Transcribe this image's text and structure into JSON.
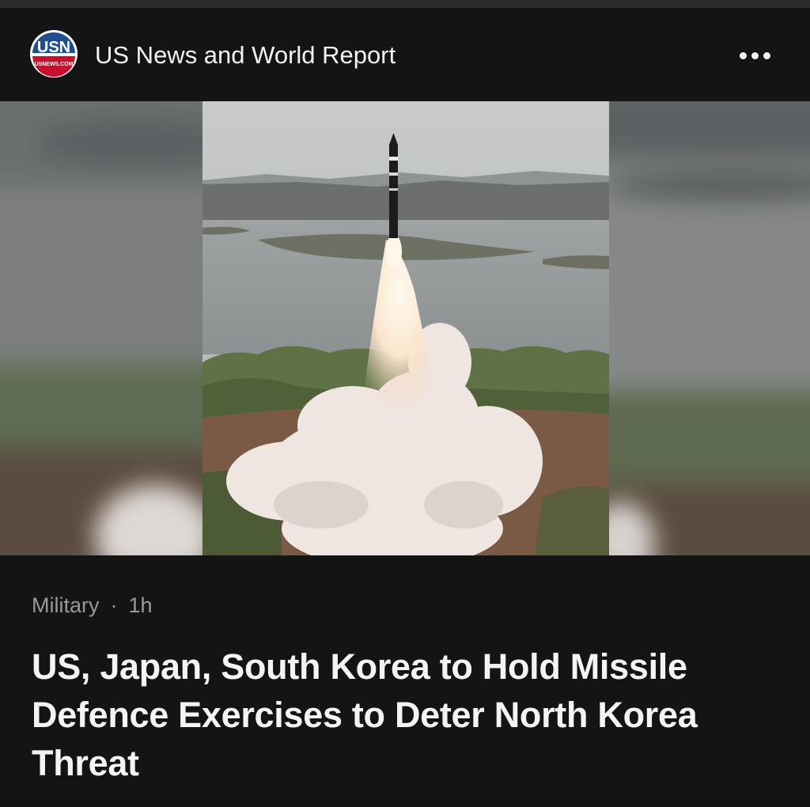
{
  "header": {
    "source_name": "US News and World Report",
    "logo": {
      "icon": "usnews-logo",
      "text": "USN",
      "subtext": "USNEWS.COM"
    },
    "more_icon": "ellipsis-icon"
  },
  "hero": {
    "image_alt": "Missile launch photo"
  },
  "article": {
    "category": "Military",
    "separator": "·",
    "age": "1h",
    "headline": "US, Japan, South Korea to Hold Missile Defence Exercises to Deter North Korea Threat"
  },
  "colors": {
    "background": "#141414",
    "text_primary": "#f4f4f4",
    "text_secondary": "#9a9a9a",
    "logo_blue": "#1f4f8f",
    "logo_red": "#c8102e"
  }
}
